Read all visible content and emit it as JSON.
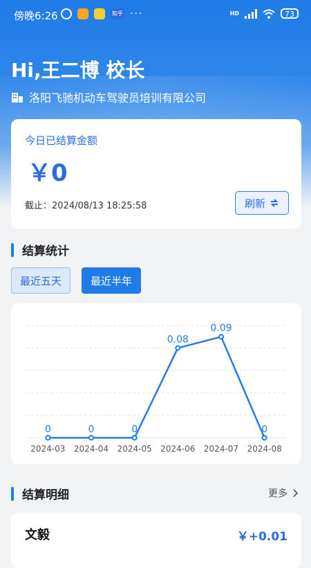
{
  "status_bar": {
    "time": "傍晚6:26",
    "hd_label": "HD",
    "battery": "73",
    "more_dots": "···",
    "mini_app3_label": "知乎"
  },
  "header": {
    "greeting": "Hi,王二博 校长",
    "school_name": "洛阳飞驰机动车驾驶员培训有限公司"
  },
  "amount_card": {
    "label": "今日已结算金额",
    "value": "￥0",
    "deadline": "截止：2024/08/13 18:25:58",
    "refresh_label": "刷新"
  },
  "stats_section": {
    "title": "结算统计",
    "tabs": [
      {
        "label": "最近五天",
        "active": false
      },
      {
        "label": "最近半年",
        "active": true
      }
    ]
  },
  "chart_data": {
    "type": "line",
    "categories": [
      "2024-03",
      "2024-04",
      "2024-05",
      "2024-06",
      "2024-07",
      "2024-08"
    ],
    "values": [
      0,
      0,
      0,
      0.08,
      0.09,
      0
    ],
    "value_labels": [
      "0",
      "0",
      "0",
      "0.08",
      "0.09",
      "0"
    ],
    "ylim": [
      0,
      0.1
    ],
    "grid": true,
    "legend": "none",
    "color": "#1f7be6"
  },
  "detail_section": {
    "title": "结算明细",
    "more_label": "更多",
    "items": [
      {
        "name": "文毅",
        "amount": "￥+0.01"
      }
    ]
  }
}
